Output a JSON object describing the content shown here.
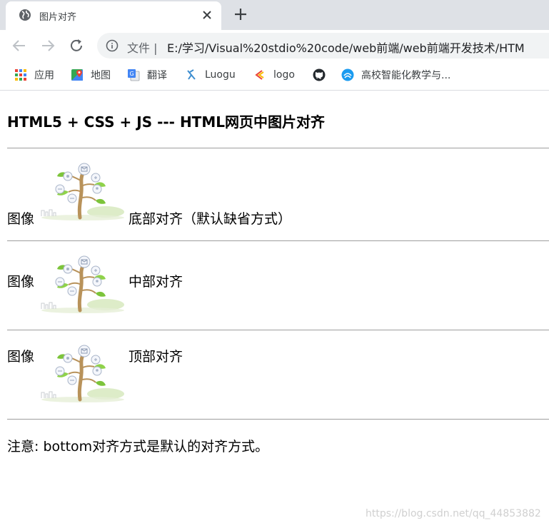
{
  "browser": {
    "tab": {
      "title": "图片对齐",
      "favicon": "globe-icon"
    },
    "toolbar": {
      "scheme_label": "文件 |",
      "url": "E:/学习/Visual%20stdio%20code/web前端/web前端开发技术/HTM"
    },
    "bookmarks": [
      {
        "label": "应用",
        "icon": "apps-grid-icon"
      },
      {
        "label": "地图",
        "icon": "maps-icon"
      },
      {
        "label": "翻译",
        "icon": "translate-icon"
      },
      {
        "label": "Luogu",
        "icon": "luogu-icon"
      },
      {
        "label": "logo",
        "icon": "logo-icon"
      },
      {
        "label": "",
        "icon": "github-icon"
      },
      {
        "label": "高校智能化教学与...",
        "icon": "school-icon"
      }
    ]
  },
  "page": {
    "title": "HTML5 + CSS + JS --- HTML网页中图片对齐",
    "rows": [
      {
        "label": "图像",
        "text": "底部对齐（默认缺省方式）",
        "align": "bottom"
      },
      {
        "label": "图像",
        "text": "中部对齐",
        "align": "middle"
      },
      {
        "label": "图像",
        "text": "顶部对齐",
        "align": "top"
      }
    ],
    "note": "注意: bottom对齐方式是默认的对齐方式。",
    "watermark": "https://blog.csdn.net/qq_44853882"
  },
  "colors": {
    "tabstrip_bg": "#dee1e6",
    "omnibox_bg": "#f1f3f4",
    "rule": "#9e9e9e",
    "tree_trunk": "#b8925a",
    "leaf_green": "#7cc43a"
  }
}
